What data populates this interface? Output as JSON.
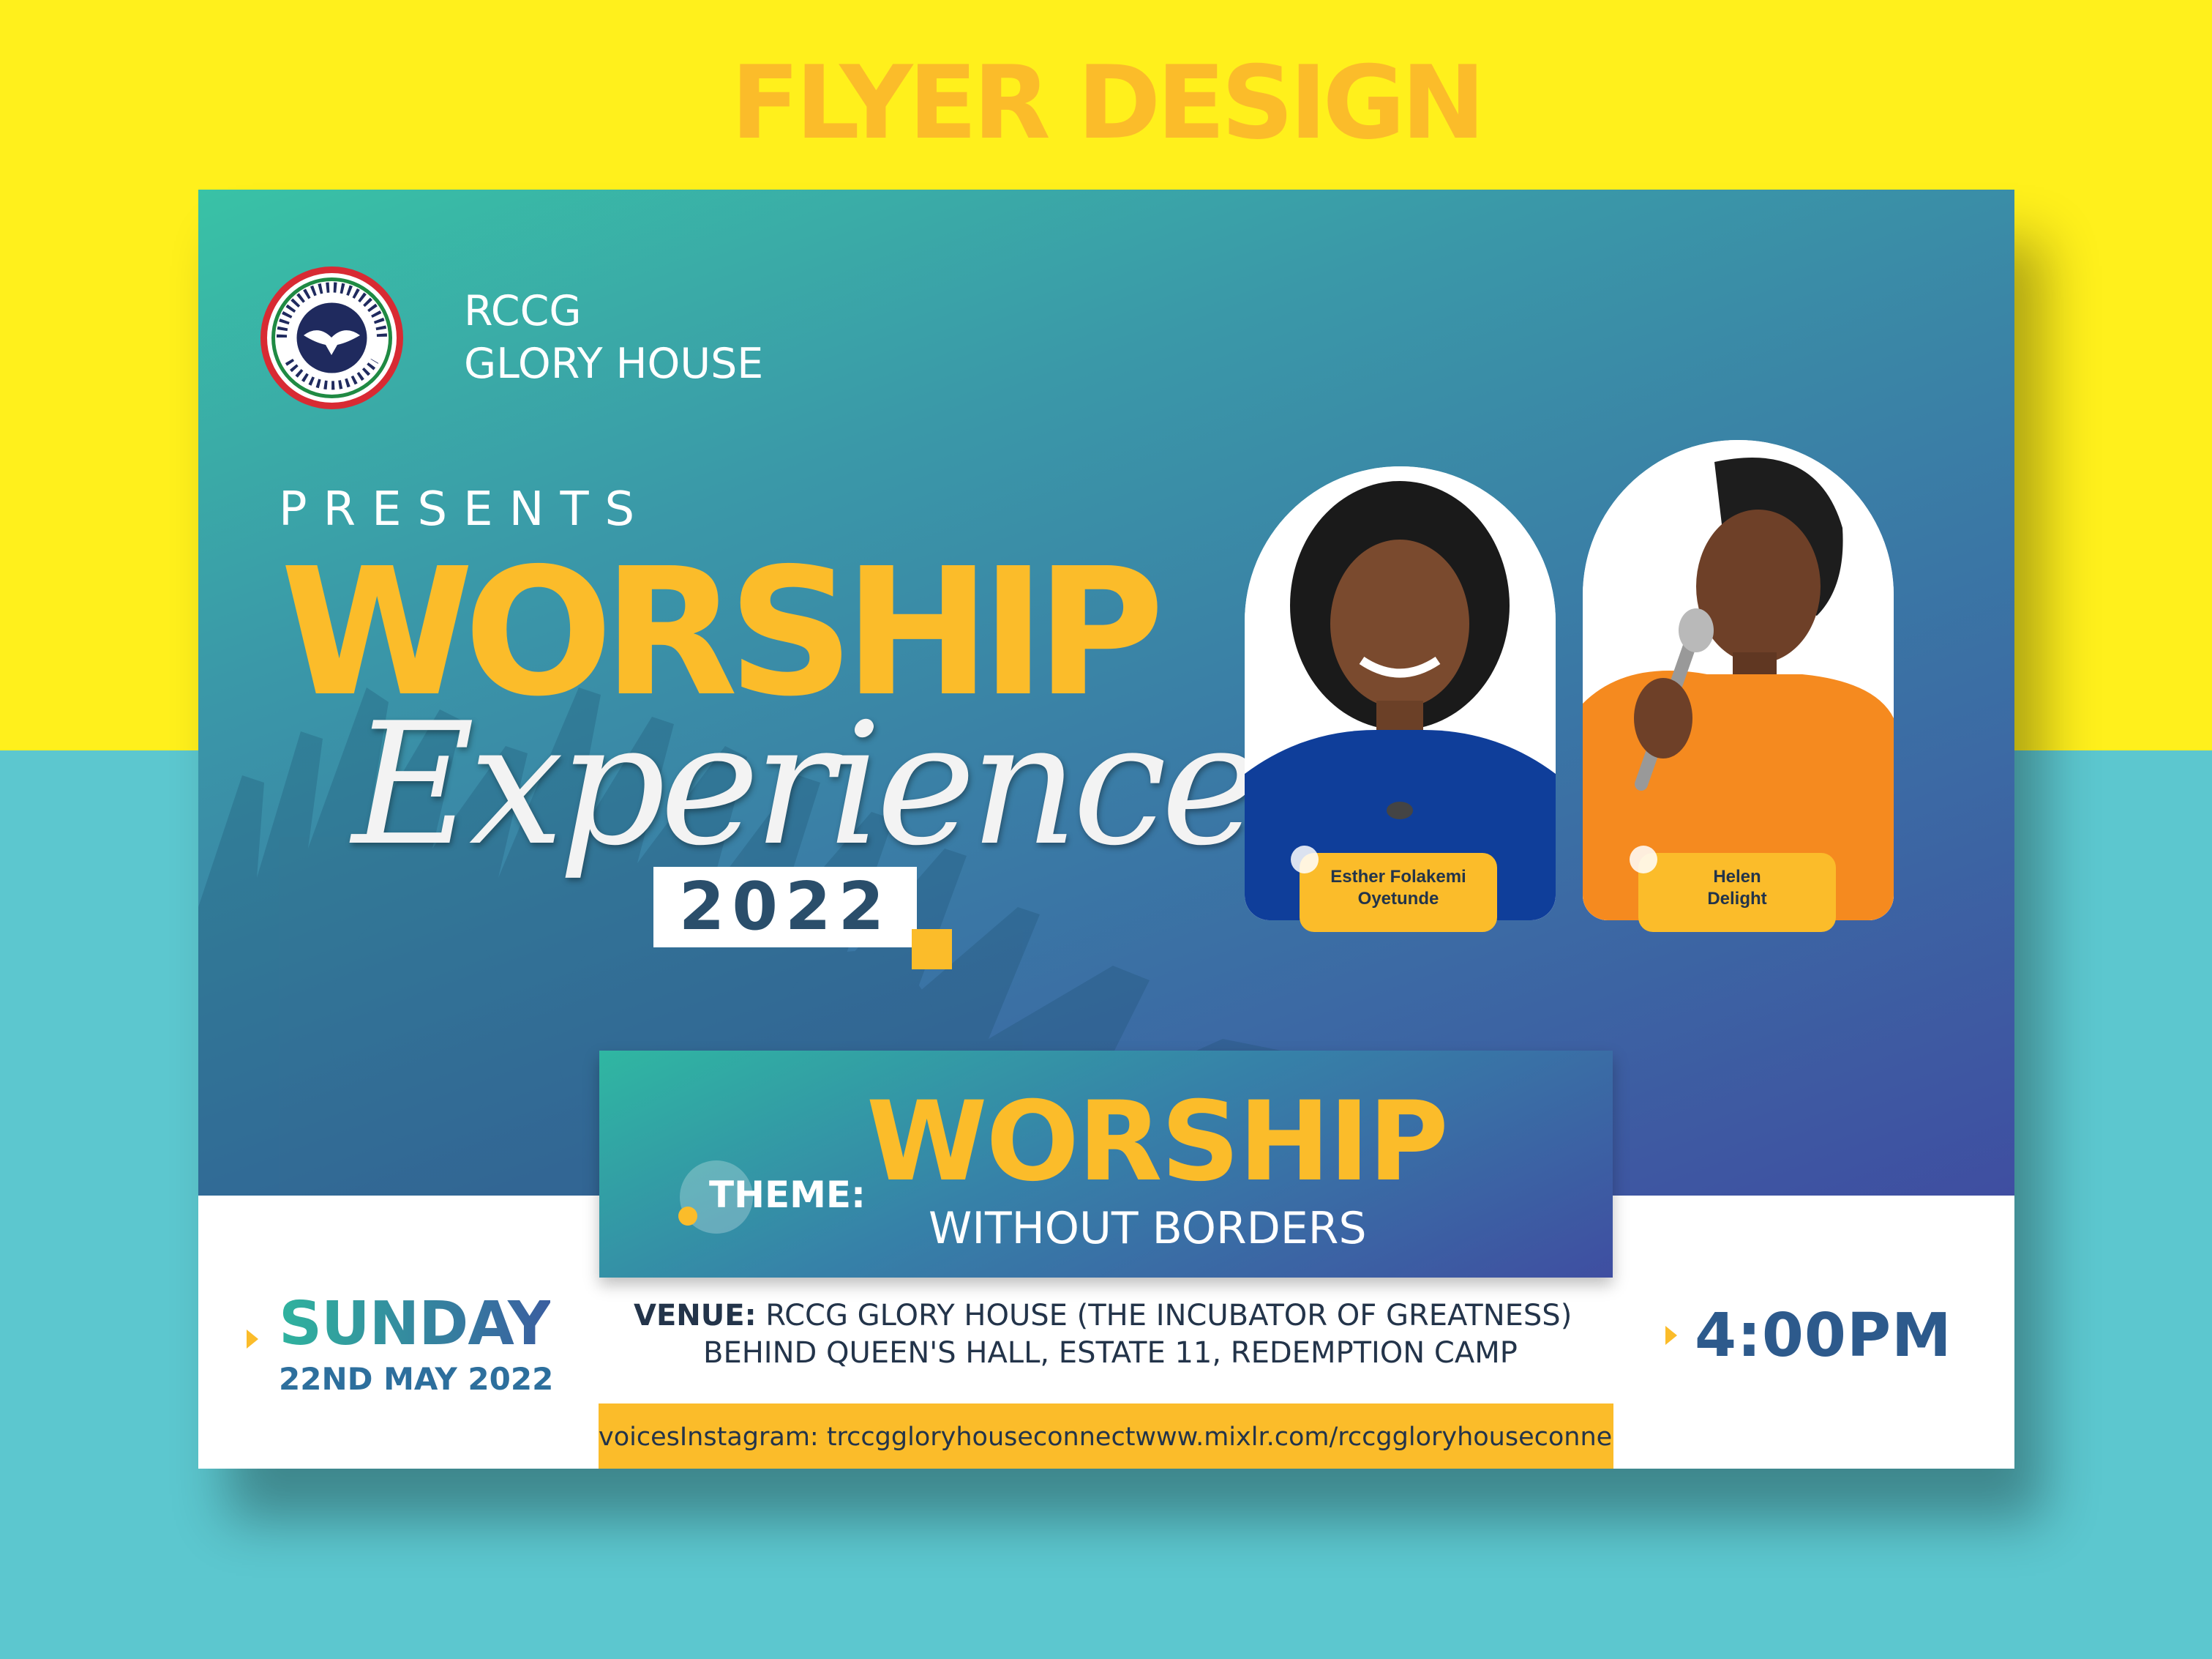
{
  "page": {
    "heading": "FLYER DESIGN"
  },
  "flyer": {
    "logo": {
      "icon": "dove-icon",
      "ring_text_top": "THE REDEEMED CHRISTIAN",
      "ring_text_bottom": "CHURCH OF GOD"
    },
    "org_line1": "RCCG",
    "org_line2": "GLORY HOUSE",
    "presents": "PRESENTS",
    "title_main": "WORSHIP",
    "title_script": "Experience",
    "year": "2022",
    "speakers": [
      {
        "line1": "Esther Folakemi",
        "line2": "Oyetunde"
      },
      {
        "line1": "Helen",
        "line2": "Delight"
      }
    ],
    "theme": {
      "label": "THEME:",
      "title": "WORSHIP",
      "subtitle": "WITHOUT BORDERS"
    },
    "day": "SUNDAY",
    "date": "22ND MAY 2022",
    "venue_label": "VENUE:",
    "venue_line1": "RCCG GLORY HOUSE (THE INCUBATOR OF GREATNESS)",
    "venue_line2": "BEHIND QUEEN'S HALL, ESTATE 11, REDEMPTION CAMP",
    "time": "4:00PM",
    "social": "voicesInstagram: trccggloryhouseconnectwww.mixlr.com/rccggloryhouseconnec"
  },
  "colors": {
    "yellow_bg": "#fff01c",
    "teal_bg": "#5cc7cf",
    "accent": "#fbbc2a",
    "navy_text": "#23344a"
  }
}
